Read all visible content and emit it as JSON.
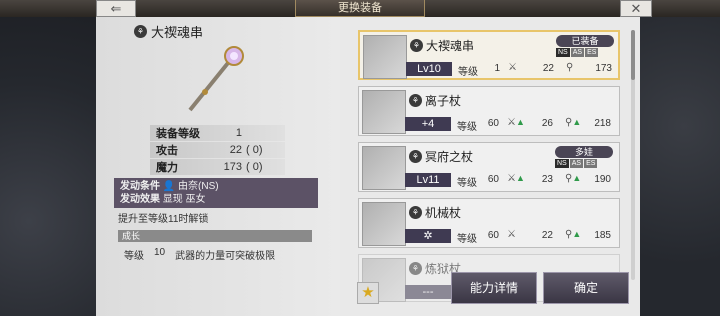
{
  "header": {
    "title": "更换装备",
    "back_icon": "back-arrow-icon",
    "close_icon": "close-icon"
  },
  "detail": {
    "name": "大禊魂串",
    "stats": [
      {
        "label": "装备等级",
        "value": "1",
        "plus": ""
      },
      {
        "label": "攻击",
        "value": "22",
        "plus": "( 0)"
      },
      {
        "label": "魔力",
        "value": "173",
        "plus": "( 0)"
      }
    ],
    "condition_label": "发动条件",
    "condition_value": "由奈(NS)",
    "effect_label": "发动效果",
    "effect_value": "显现 巫女",
    "unlock": "提升至等级11时解锁",
    "growth_title": "成长",
    "growth_rows": [
      {
        "label": "等级",
        "value": "10",
        "desc": "武器的力量可突破极限"
      }
    ]
  },
  "list": {
    "stat_label": "等级",
    "items": [
      {
        "name": "大禊魂串",
        "badge": "Lv10",
        "grade": "1",
        "atk": "22",
        "mag": "173",
        "tag": "已装备",
        "subtags": [
          "NS",
          "AS",
          "ES"
        ],
        "selected": true
      },
      {
        "name": "离子杖",
        "badge": "+4",
        "grade": "60",
        "atk": "26",
        "mag": "218",
        "tag": "",
        "subtags": [],
        "selected": false
      },
      {
        "name": "冥府之杖",
        "badge": "Lv11",
        "grade": "60",
        "atk": "23",
        "mag": "190",
        "tag": "多娃",
        "subtags": [
          "NS",
          "AS",
          "ES"
        ],
        "selected": false
      },
      {
        "name": "机械杖",
        "badge": "✲",
        "grade": "60",
        "atk": "22",
        "mag": "185",
        "tag": "",
        "subtags": [],
        "selected": false
      },
      {
        "name": "炼狱杖",
        "badge": "---",
        "grade": "",
        "atk": "",
        "mag": "",
        "tag": "",
        "subtags": [],
        "selected": false
      }
    ]
  },
  "actions": {
    "detail": "能力详情",
    "confirm": "确定"
  }
}
